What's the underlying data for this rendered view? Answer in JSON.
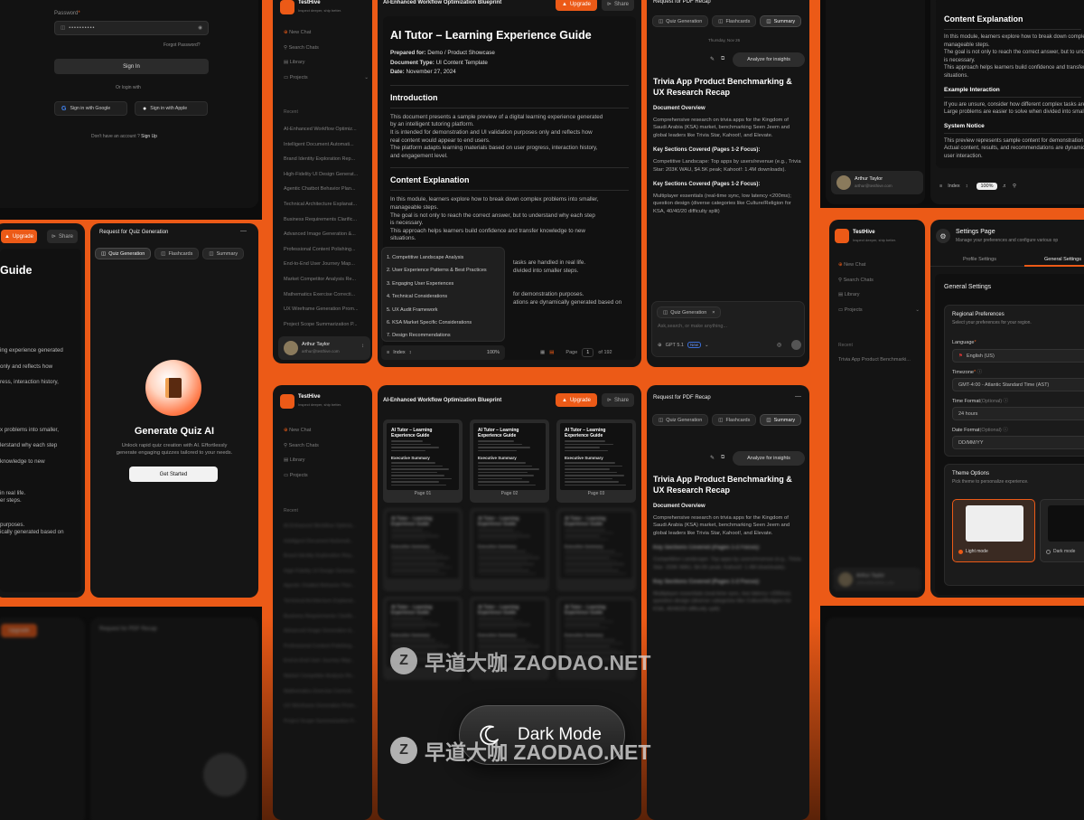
{
  "brand": {
    "name": "TestHive",
    "tagline": "Inspect deeper, ship better."
  },
  "login": {
    "password_label": "Password",
    "password_value": "••••••••••",
    "forgot": "Forgot Password?",
    "sign_in": "Sign In",
    "or_login": "Or login with",
    "google": "Sign in with Google",
    "apple": "Sign in with Apple",
    "no_account": "Don't have an account ?",
    "sign_up": "Sign Up"
  },
  "sidebar": {
    "new_chat": "New Chat",
    "search_chats": "Search Chats",
    "library": "Library",
    "projects": "Projects",
    "recent": "Recent",
    "recent_items": [
      "AI-Enhanced Workflow Optimiz...",
      "Intelligent Document Automati...",
      "Brand Identity Exploration Rep...",
      "High-Fidelity UI Design Generat...",
      "Agentic Chatbot Behavior Plan...",
      "Technical Architecture Explanat...",
      "Business Requirements Clarific...",
      "Advanced Image Generation &...",
      "Professional Content Polishing...",
      "End-to-End User Journey Map...",
      "Market Competitor Analysis Re...",
      "Mathematics Exercise Correcti...",
      "UX Wireframe Generation Prom...",
      "Project Scope Summarization P..."
    ],
    "settings_recent_item": "Trivia App Product Benchmarki...",
    "user_name": "Arthur Taylor",
    "user_email": "arthur@testhive.com"
  },
  "doc_header": {
    "title": "AI-Enhanced Workflow Optimization Blueprint",
    "upgrade": "Upgrade",
    "share": "Share"
  },
  "document": {
    "title": "AI Tutor – Learning Experience Guide",
    "prepared_label": "Prepared for:",
    "prepared_value": "Demo / Product Showcase",
    "type_label": "Document Type:",
    "type_value": "UI Content Template",
    "date_label": "Date:",
    "date_value": "November 27, 2024",
    "intro_heading": "Introduction",
    "intro_lines": [
      "This document presents a sample preview of a digital learning experience generated",
      "by an intelligent tutoring platform.",
      "It is intended for demonstration and UI validation purposes only and reflects how",
      "real content would appear to end users.",
      "The platform adapts learning materials based on user progress, interaction history,",
      "and engagement level."
    ],
    "content_heading": "Content Explanation",
    "content_lines": [
      "In this module, learners explore how to break down complex problems into smaller,",
      "manageable steps.",
      "The goal is not only to reach the correct answer, but to understand why each step",
      "is necessary.",
      "This approach helps learners build confidence and transfer knowledge to new",
      "situations."
    ],
    "partial_lines": [
      "tasks are handled in real life.",
      "divided into smaller steps."
    ],
    "partial_lines_2": [
      "for demonstration purposes.",
      "ations are dynamically generated based on"
    ],
    "example_heading": "Example Interaction",
    "example_lines": [
      "If you are unsure, consider how different complex tasks are handled in real life.",
      "Large problems are easier to solve when divided into smaller steps."
    ],
    "notice_heading": "System Notice",
    "notice_lines": [
      "This preview represents sample content for demonstration purposes.",
      "Actual content, results, and recommendations are dynamically generated based on",
      "user interaction."
    ]
  },
  "toc": {
    "items": [
      "1. Competitive Landscape Analysis",
      "2. User Experience Patterns & Best Practices",
      "3. Engaging User Experiences",
      "4. Technical Considerations",
      "5. UX Audit Framework",
      "6. KSA Market Specific Considerations",
      "7. Design Recommendations"
    ],
    "index_label": "Index",
    "zoom": "100%",
    "page_label": "Page",
    "page_current": "1",
    "page_total": "of 192"
  },
  "pdf_panel": {
    "title": "Request for PDF Recap",
    "tabs": [
      "Quiz Generation",
      "Flashcards",
      "Summary"
    ],
    "date": "Thursday, Nov 26",
    "analyze": "Analyze for insights",
    "recap_title": "Trivia App Product Benchmarking & UX Research Recap",
    "overview_heading": "Document Overview",
    "overview_text": "Comprehensive research on trivia apps for the Kingdom of Saudi Arabia (KSA) market, benchmarking Seen Jeem and global leaders like Trivia Star, Kahoot!, and Elevate.",
    "key1_heading": "Key Sections Covered (Pages 1-2 Focus):",
    "key1_text": "Competitive Landscape: Top apps by users/revenue (e.g., Trivia Star: 203K WAU, $4.5K peak; Kahoot!: 1.4M downloads).",
    "key2_heading": "Key Sections Covered (Pages 1-2 Focus):",
    "key2_text": "Multiplayer essentials (real-time sync, low latency <200ms); question design (diverse categories like Culture/Religion for KSA, 40/40/20 difficulty split)",
    "chip": "Quiz Generation",
    "input_placeholder": "Ask,search, or make anything...",
    "model": "GPT 5.1",
    "model_badge": "New"
  },
  "quiz_panel": {
    "title": "Request for Quiz Generation",
    "heading": "Generate Quiz AI",
    "desc_lines": [
      "Unlock rapid quiz creation with AI. Effortlessly",
      "generate engaging quizzes tailored to your needs."
    ],
    "cta": "Get Started",
    "partial_title": "Guide",
    "partial_lines": [
      "ing experience generated",
      "only and reflects how",
      "ress, interaction history,",
      "x problems into smaller,",
      "lerstand why each step",
      "knowledge to new",
      "in real life.",
      "er steps.",
      "purposes.",
      "ically generated based on"
    ]
  },
  "settings": {
    "title": "Settings Page",
    "subtitle": "Manage your preferences and configure various op",
    "tabs": [
      "Profile Settings",
      "General Settings"
    ],
    "general_heading": "General Settings",
    "regional_heading": "Regional Preferences",
    "regional_sub": "Select your preferences for your region.",
    "language_label": "Language",
    "language_value": "English (US)",
    "timezone_label": "Timezone",
    "timezone_value": "GMT-4:00 - Atlantic Standard Time (AST)",
    "time_format_label": "Time Format",
    "optional": "(Optional)",
    "time_format_value": "24 hours",
    "date_format_label": "Date Format",
    "date_format_value": "DD/MM/YY",
    "theme_heading": "Theme Options",
    "theme_sub": "Pick theme to personalize experience.",
    "light_mode": "Light mode",
    "dark_mode": "Dark mode"
  },
  "thumbs": {
    "title": "AI Tutor – Learning Experience Guide",
    "section": "Executive Summary",
    "pages": [
      "Page 01",
      "Page 02",
      "Page 03"
    ]
  },
  "badge": {
    "label": "Dark Mode"
  },
  "watermark": {
    "text": "早道大咖 ZAODAO.NET"
  }
}
